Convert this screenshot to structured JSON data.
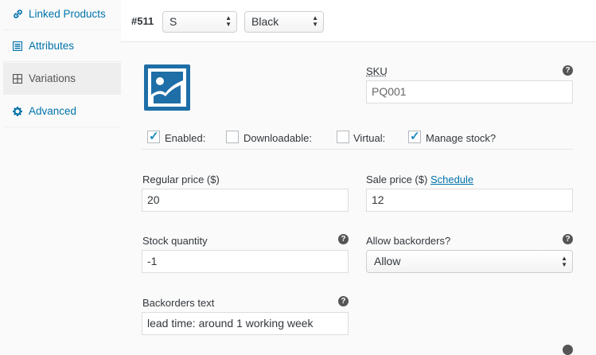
{
  "sidebar": {
    "items": [
      {
        "label": "Linked Products",
        "icon": "link-icon"
      },
      {
        "label": "Attributes",
        "icon": "list-icon"
      },
      {
        "label": "Variations",
        "icon": "grid-icon"
      },
      {
        "label": "Advanced",
        "icon": "gear-icon"
      }
    ]
  },
  "variation": {
    "number": "#511",
    "size_select": "S",
    "color_select": "Black"
  },
  "sku": {
    "label": "SKU",
    "value": "PQ001"
  },
  "checkboxes": {
    "enabled": {
      "label": "Enabled:",
      "checked": true
    },
    "downloadable": {
      "label": "Downloadable:",
      "checked": false
    },
    "virtual": {
      "label": "Virtual:",
      "checked": false
    },
    "manage_stock": {
      "label": "Manage stock?",
      "checked": true
    }
  },
  "regular_price": {
    "label": "Regular price ($)",
    "value": "20"
  },
  "sale_price": {
    "label": "Sale price ($)",
    "link": "Schedule",
    "value": "12"
  },
  "stock_quantity": {
    "label": "Stock quantity",
    "value": "-1"
  },
  "allow_backorders": {
    "label": "Allow backorders?",
    "value": "Allow"
  },
  "backorders_text": {
    "label": "Backorders text",
    "value": "lead time: around 1 working week"
  },
  "help_glyph": "?",
  "colors": {
    "accent": "#0073aa",
    "image_icon": "#1e6ea7",
    "checkmark": "#1e8cbe"
  }
}
